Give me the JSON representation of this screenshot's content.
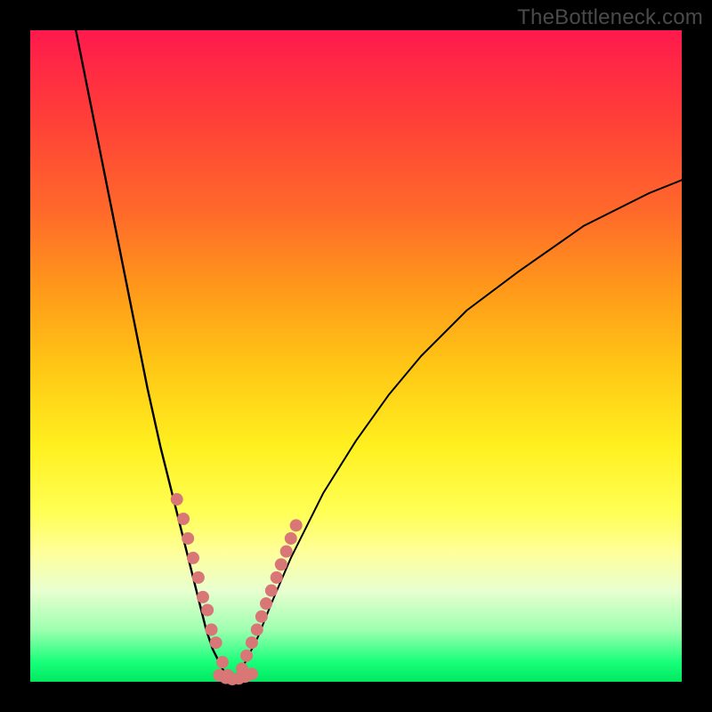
{
  "watermark": "TheBottleneck.com",
  "chart_data": {
    "type": "line",
    "title": "",
    "xlabel": "",
    "ylabel": "",
    "xlim": [
      0,
      100
    ],
    "ylim": [
      0,
      100
    ],
    "grid": false,
    "legend": false,
    "annotations": [],
    "series": [
      {
        "name": "left-curve",
        "color": "#000000",
        "x": [
          7,
          10,
          13,
          16,
          18,
          20,
          22,
          24,
          25,
          26,
          27,
          28,
          29,
          30,
          31
        ],
        "y": [
          100,
          85,
          70,
          55,
          45,
          36,
          28,
          20,
          16,
          12,
          8,
          5,
          3,
          1,
          0
        ]
      },
      {
        "name": "right-curve",
        "color": "#000000",
        "x": [
          31,
          33,
          35,
          37,
          40,
          45,
          50,
          55,
          60,
          67,
          75,
          85,
          95,
          100
        ],
        "y": [
          0,
          3,
          7,
          12,
          19,
          29,
          37,
          44,
          50,
          57,
          63,
          70,
          75,
          77
        ]
      },
      {
        "name": "left-dots",
        "color": "#d97777",
        "x": [
          22.5,
          23.5,
          24.2,
          25.0,
          25.8,
          26.5,
          27.2,
          27.8,
          28.5,
          29.5,
          30.3
        ],
        "y": [
          28,
          25,
          22,
          19,
          16,
          13,
          11,
          8,
          6,
          3,
          1
        ]
      },
      {
        "name": "right-dots",
        "color": "#d97777",
        "x": [
          32.5,
          33.2,
          34.0,
          34.8,
          35.5,
          36.2,
          37.0,
          37.8,
          38.5,
          39.3,
          40.0,
          40.8
        ],
        "y": [
          2,
          4,
          6,
          8,
          10,
          12,
          14,
          16,
          18,
          20,
          22,
          24
        ]
      },
      {
        "name": "bottom-dots",
        "color": "#d97777",
        "x": [
          29.0,
          30.0,
          31.0,
          32.0,
          33.0,
          34.0
        ],
        "y": [
          1.0,
          0.6,
          0.4,
          0.5,
          0.8,
          1.2
        ]
      }
    ],
    "background_gradient": {
      "top": "#ff1a4d",
      "mid": "#fff020",
      "bottom": "#00e860"
    }
  }
}
